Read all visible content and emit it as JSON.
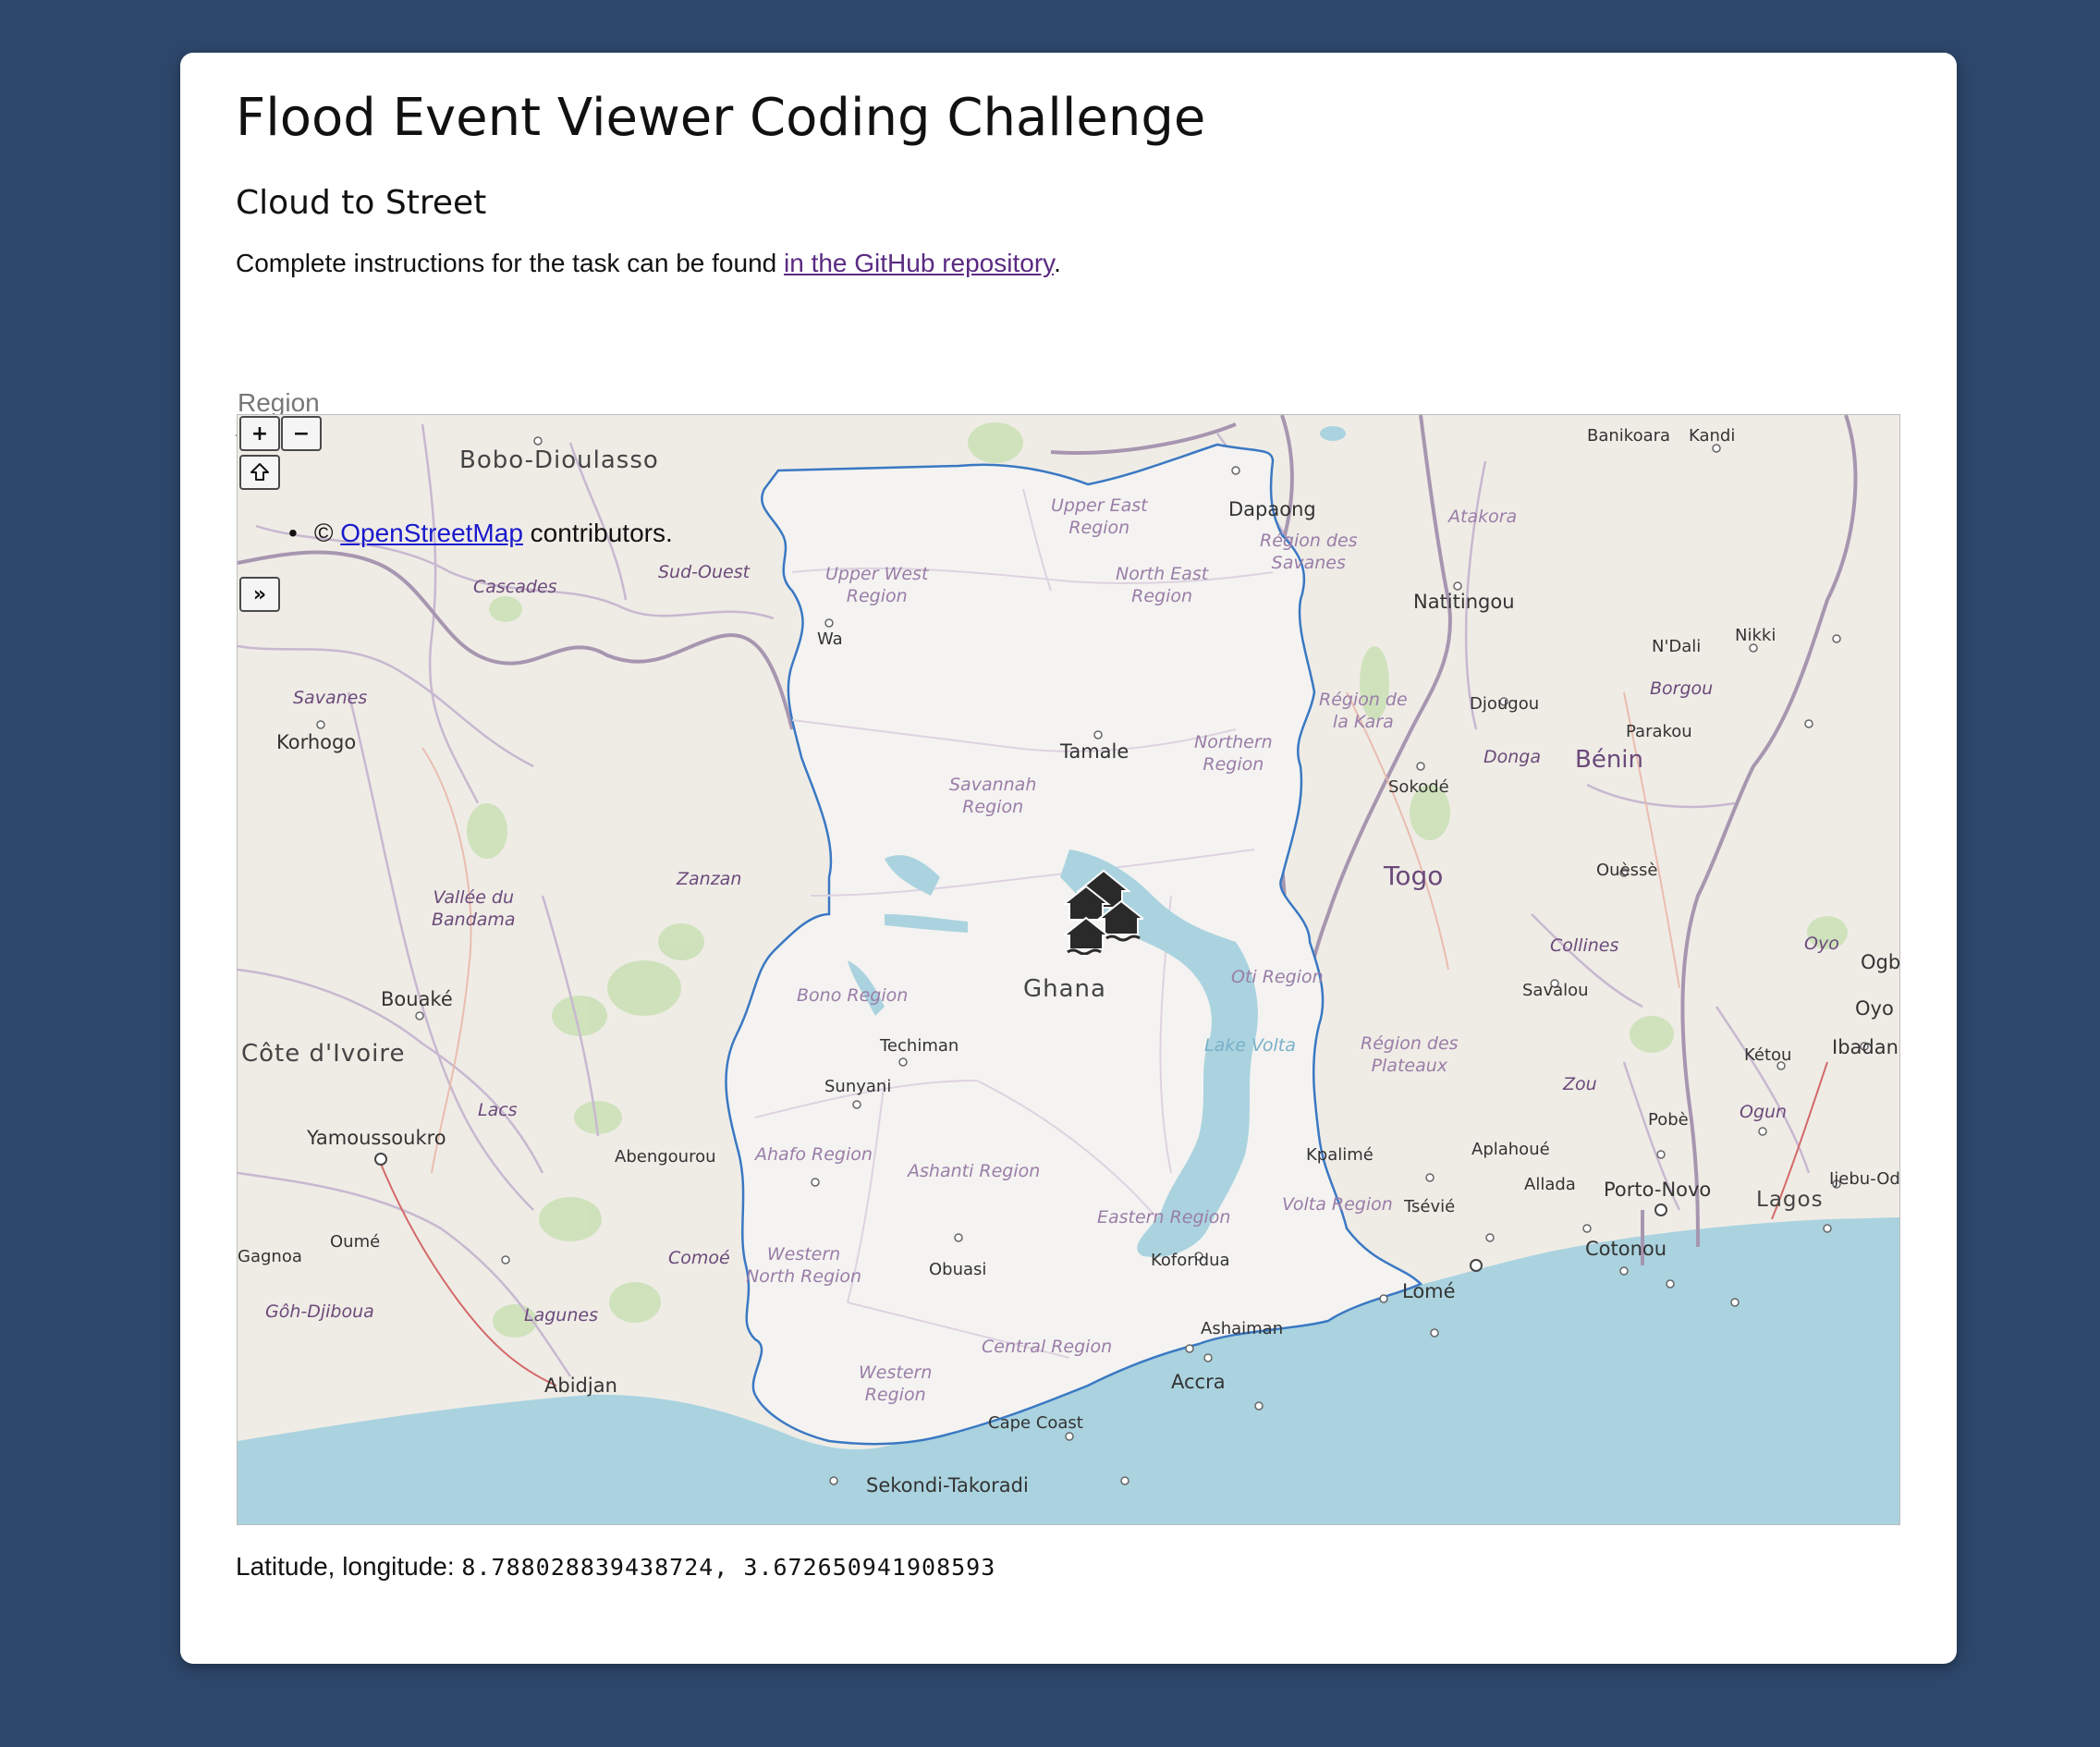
{
  "page": {
    "title": "Flood Event Viewer Coding Challenge",
    "subtitle": "Cloud to Street",
    "instructions_prefix": "Complete instructions for the task can be found ",
    "instructions_link": "in the GitHub repository",
    "instructions_suffix": "."
  },
  "region_input": {
    "placeholder": "Region",
    "value": ""
  },
  "map": {
    "controls": {
      "zoom_in": "+",
      "zoom_out": "−",
      "home_icon": "home-icon",
      "expand": "»"
    },
    "attribution": {
      "bullet": "•",
      "prefix": "© ",
      "link": "OpenStreetMap",
      "suffix": " contributors."
    },
    "marker_icon": "flood-house-icon",
    "labels": {
      "bobo": "Bobo-Dioulasso",
      "banikoara": "Banikoara",
      "kandi": "Kandi",
      "dapaong": "Dapaong",
      "atakora": "Atakora",
      "savanes_tg": "Région des\nSavanes",
      "natitingou": "Natitingou",
      "sud_ouest": "Sud-Ouest",
      "cascades": "Cascades",
      "upper_east": "Upper East\nRegion",
      "upper_west": "Upper West\nRegion",
      "north_east": "North East\nRegion",
      "wa": "Wa",
      "savanes_ci": "Savanes",
      "korhogo": "Korhogo",
      "kara": "Région de\nla Kara",
      "djougou": "Djougou",
      "ndali": "N'Dali",
      "nikki": "Nikki",
      "borgou": "Borgou",
      "parakou": "Parakou",
      "donga": "Donga",
      "benin": "Bénin",
      "tamale": "Tamale",
      "northern": "Northern\nRegion",
      "savannah": "Savannah\nRegion",
      "sokode": "Sokodé",
      "togo": "Togo",
      "ouesse": "Ouèssè",
      "zanzan": "Zanzan",
      "bandama": "Vallée du\nBandama",
      "collines": "Collines",
      "oyo_region": "Oyo",
      "savalou": "Savalou",
      "bouake": "Bouaké",
      "ghana": "Ghana",
      "bono": "Bono Region",
      "oti": "Oti Region",
      "cote_divoire": "Côte d'Ivoire",
      "techiman": "Techiman",
      "lake_volta": "Lake Volta",
      "plateaux": "Région des\nPlateaux",
      "ketou": "Kétou",
      "ibadan": "Ibadan",
      "ogb": "Ogb",
      "oyo_city": "Oyo",
      "sunyani": "Sunyani",
      "zou": "Zou",
      "ogun": "Ogun",
      "lacs": "Lacs",
      "yamoussoukro": "Yamoussoukro",
      "abengourou": "Abengourou",
      "ahafo": "Ahafo Region",
      "kpalime": "Kpalimé",
      "aplahoue": "Aplahoué",
      "pobe": "Pobè",
      "allada": "Allada",
      "porto_novo": "Porto-Novo",
      "ijebu": "Ijebu-Od",
      "lagos": "Lagos",
      "ashanti": "Ashanti Region",
      "eastern": "Eastern Region",
      "volta": "Volta Region",
      "tsevie": "Tsévié",
      "cotonou": "Cotonou",
      "gagnoa": "Gagnoa",
      "oume": "Oumé",
      "comoe": "Comoé",
      "western_north": "Western\nNorth Region",
      "obuasi": "Obuasi",
      "koforidua": "Koforidua",
      "lome": "Lomé",
      "goh": "Gôh-Djiboua",
      "lagunes": "Lagunes",
      "ashaiman": "Ashaiman",
      "central": "Central Region",
      "abidjan": "Abidjan",
      "western": "Western\nRegion",
      "accra": "Accra",
      "cape_coast": "Cape Coast",
      "sekondi": "Sekondi-Takoradi"
    }
  },
  "coordinates": {
    "label": "Latitude, longitude: ",
    "value": "8.788028839438724, 3.672650941908593"
  },
  "colors": {
    "background": "#2d476b",
    "card": "#ffffff",
    "ocean": "#aad3df",
    "land": "#efece6",
    "ghana_land": "#f4f3f1",
    "ghana_border": "#3a78c3",
    "forest": "#c9e0b4"
  }
}
